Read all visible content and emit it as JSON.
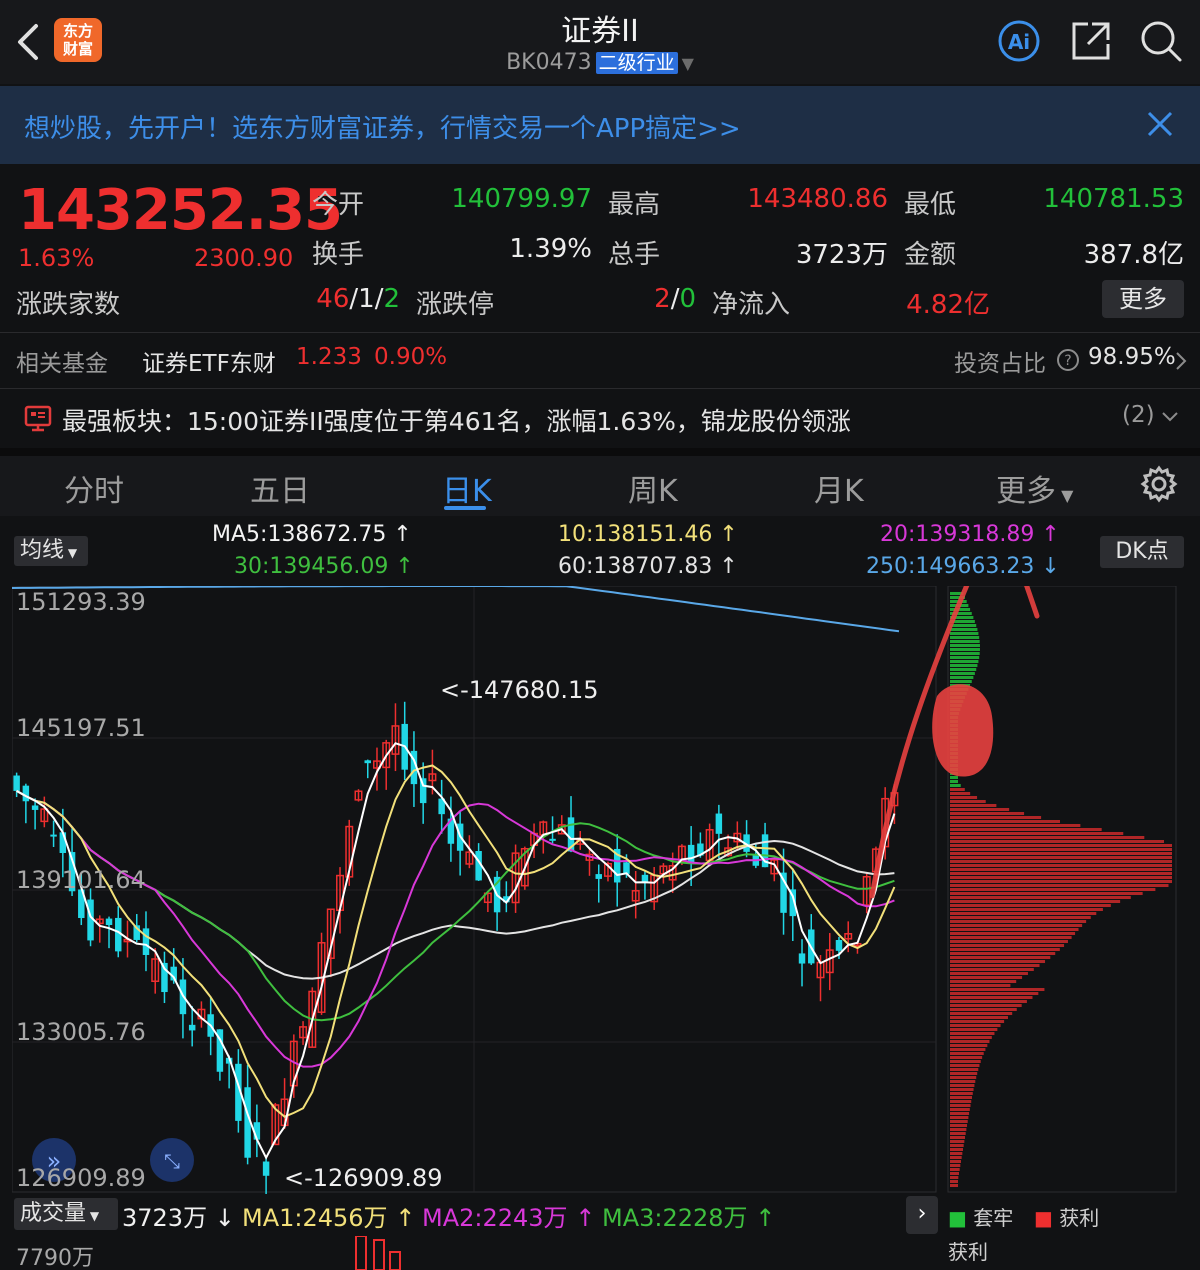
{
  "header": {
    "logo_text_line1": "东方",
    "logo_text_line2": "财富",
    "title": "证券II",
    "code": "BK0473",
    "tag": "二级行业"
  },
  "banner": {
    "text": "想炒股，先开户！选东方财富证券，行情交易一个APP搞定>>"
  },
  "quote": {
    "price": "143252.35",
    "pct": "1.63%",
    "change": "2300.90",
    "open_label": "今开",
    "open": "140799.97",
    "high_label": "最高",
    "high": "143480.86",
    "low_label": "最低",
    "low": "140781.53",
    "turnover_label": "换手",
    "turnover": "1.39%",
    "volume_label": "总手",
    "volume": "3723万",
    "amount_label": "金额",
    "amount": "387.8亿",
    "updown_label": "涨跌家数",
    "up": "46",
    "flat": "1",
    "down": "2",
    "limit_label": "涨跌停",
    "limit_up": "2",
    "limit_down": "0",
    "inflow_label": "净流入",
    "inflow": "4.82亿",
    "more_label": "更多"
  },
  "fund": {
    "label": "相关基金",
    "name": "证券ETF东财",
    "price": "1.233",
    "pct": "0.90%",
    "ratio_label": "投资占比",
    "ratio": "98.95%"
  },
  "strong": {
    "text": "最强板块：15:00证券II强度位于第461名，涨幅1.63%，锦龙股份领涨",
    "count": "(2)"
  },
  "tabs": [
    {
      "label": "分时"
    },
    {
      "label": "五日"
    },
    {
      "label": "日K"
    },
    {
      "label": "周K"
    },
    {
      "label": "月K"
    },
    {
      "label": "更多"
    }
  ],
  "ma": {
    "button": "均线",
    "ma5": "MA5:138672.75",
    "ma10": "10:138151.46",
    "ma20": "20:139318.89",
    "ma30": "30:139456.09",
    "ma60": "60:138707.83",
    "ma250": "250:149663.23",
    "dk": "DK点"
  },
  "axis": {
    "y1": "151293.39",
    "y2": "145197.51",
    "y3": "139101.64",
    "y4": "133005.76",
    "y5": "126909.89",
    "high_mark": "<-147680.15",
    "low_mark": "<-126909.89"
  },
  "volume": {
    "button": "成交量",
    "vol": "3723万",
    "ma1": "MA1:2456万",
    "ma2": "MA2:2243万",
    "ma3": "MA3:2228万",
    "max": "7790万"
  },
  "chip_legend": {
    "trapped": "套牢",
    "profit": "获利",
    "profit_ratio": "获利"
  },
  "colors": {
    "up": "#ee2f2f",
    "down": "#21d7e6",
    "accent": "#3b8fea",
    "ma5": "#ffffff",
    "ma10": "#f2e07a",
    "ma20": "#d838d8",
    "ma30": "#3fbf3f",
    "ma250": "#5aa8e8"
  }
}
